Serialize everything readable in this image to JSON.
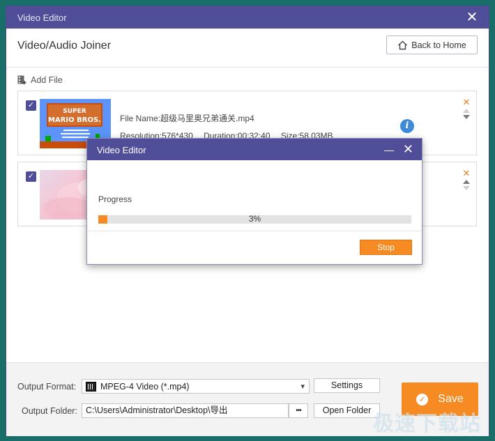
{
  "window": {
    "title": "Video Editor"
  },
  "header": {
    "title": "Video/Audio Joiner",
    "back_label": "Back to Home"
  },
  "toolbar": {
    "add_file_label": "Add File"
  },
  "files": [
    {
      "name": "File Name:超级马里奥兄弟通关.mp4",
      "resolution": "Resolution:576*430",
      "duration": "Duration:00:32:40",
      "size": "Size:58.03MB",
      "checked": true
    },
    {
      "checked": true
    }
  ],
  "footer": {
    "output_format_label": "Output Format:",
    "output_format_value": "MPEG-4 Video (*.mp4)",
    "settings_label": "Settings",
    "output_folder_label": "Output Folder:",
    "output_folder_value": "C:\\Users\\Administrator\\Desktop\\导出",
    "browse_label": "•••",
    "open_folder_label": "Open Folder",
    "save_label": "Save"
  },
  "watermark": "极速下载站",
  "dialog": {
    "title": "Video Editor",
    "progress_label": "Progress",
    "progress_percent": 3,
    "progress_text": "3%",
    "stop_label": "Stop"
  },
  "colors": {
    "accent": "#514e99",
    "action": "#f58b22",
    "info": "#3f8ad8"
  }
}
